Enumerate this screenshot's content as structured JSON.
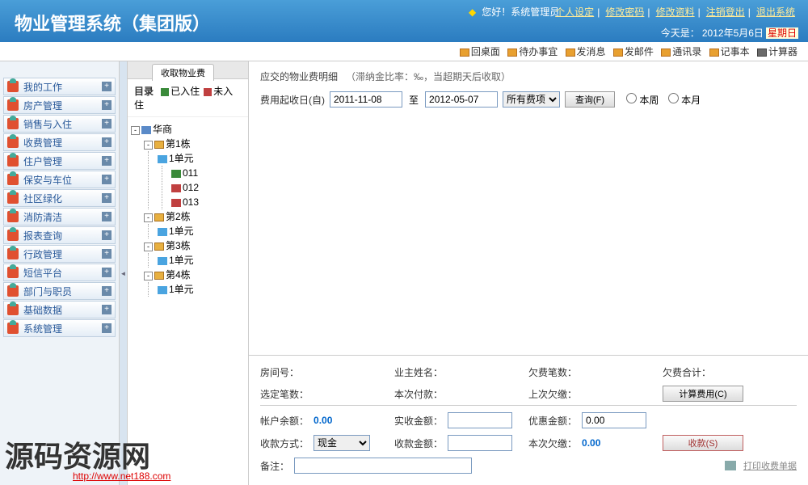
{
  "header": {
    "title": "物业管理系统（集团版）",
    "greeting": "您好！系统管理员",
    "links": {
      "profile": "个人设定",
      "password": "修改密码",
      "info": "修改资料",
      "logout": "注销登出",
      "exit": "退出系统"
    },
    "today_label": "今天是：",
    "today_date": "2012年5月6日",
    "weekday": "星期日"
  },
  "toolbar": {
    "desktop": "回桌面",
    "todo": "待办事宜",
    "message": "发消息",
    "mail": "发邮件",
    "contacts": "通讯录",
    "notes": "记事本",
    "calc": "计算器"
  },
  "nav": [
    "我的工作",
    "房产管理",
    "销售与入住",
    "收费管理",
    "住户管理",
    "保安与车位",
    "社区绿化",
    "消防清洁",
    "报表查询",
    "行政管理",
    "短信平台",
    "部门与职员",
    "基础数据",
    "系统管理"
  ],
  "tree": {
    "tab": "收取物业费",
    "legend_title": "目录",
    "legend_in": "已入住",
    "legend_out": "未入住",
    "root": "华商",
    "buildings": [
      {
        "name": "第1栋",
        "units": [
          {
            "name": "1单元",
            "rooms": [
              {
                "name": "011",
                "status": "in"
              },
              {
                "name": "012",
                "status": "out"
              },
              {
                "name": "013",
                "status": "out"
              }
            ]
          }
        ]
      },
      {
        "name": "第2栋",
        "units": [
          {
            "name": "1单元",
            "rooms": []
          }
        ]
      },
      {
        "name": "第3栋",
        "units": [
          {
            "name": "1单元",
            "rooms": []
          }
        ]
      },
      {
        "name": "第4栋",
        "units": [
          {
            "name": "1单元",
            "rooms": []
          }
        ]
      }
    ]
  },
  "content": {
    "title": "应交的物业费明细",
    "subtitle": "（滞纳金比率：‰，当超期天后收取）",
    "filter": {
      "date_label": "费用起收日(自)",
      "date_from": "2011-11-08",
      "to": "至",
      "date_to": "2012-05-07",
      "fee_type": "所有费项",
      "query_btn": "查询(F)",
      "this_week": "本周",
      "this_month": "本月"
    },
    "summary": {
      "room_no": "房间号：",
      "owner": "业主姓名：",
      "owe_count": "欠费笔数：",
      "owe_total": "欠费合计：",
      "selected": "选定笔数：",
      "this_pay": "本次付款：",
      "last_owe": "上次欠缴：",
      "calc_btn": "计算费用(C)",
      "balance": "帐户余额：",
      "balance_val": "0.00",
      "actual": "实收金额：",
      "discount": "优惠金额：",
      "discount_val": "0.00",
      "pay_method": "收款方式：",
      "pay_method_val": "现金",
      "receive_amt": "收款金额：",
      "this_owe": "本次欠缴：",
      "this_owe_val": "0.00",
      "collect_btn": "收款(S)",
      "remark": "备注：",
      "print": "打印收费单据"
    }
  },
  "watermark": {
    "text": "源码资源网",
    "url": "http://www.net188.com"
  }
}
